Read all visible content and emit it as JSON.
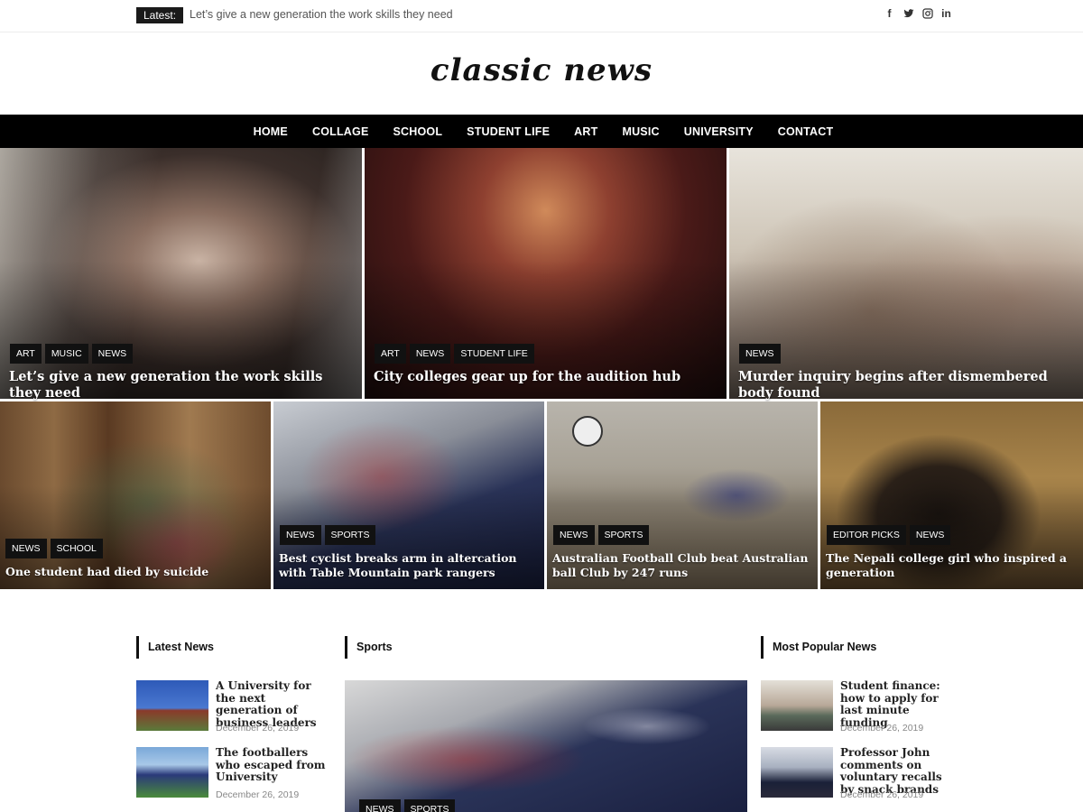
{
  "topbar": {
    "latest_label": "Latest:",
    "latest_text": "Let’s give a new generation the work skills they need",
    "social": [
      "facebook-icon",
      "twitter-icon",
      "instagram-icon",
      "linkedin-icon"
    ]
  },
  "site": {
    "logo": "classic news"
  },
  "nav": [
    "HOME",
    "COLLAGE",
    "SCHOOL",
    "STUDENT LIFE",
    "ART",
    "MUSIC",
    "UNIVERSITY",
    "CONTACT"
  ],
  "hero": [
    {
      "tags": [
        "ART",
        "MUSIC",
        "NEWS"
      ],
      "title": "Let’s give a new generation the work skills they need"
    },
    {
      "tags": [
        "ART",
        "NEWS",
        "STUDENT LIFE"
      ],
      "title": "City colleges gear up for the audition hub"
    },
    {
      "tags": [
        "NEWS"
      ],
      "title": "Murder inquiry begins after dismembered body found"
    }
  ],
  "grid": [
    {
      "tags": [
        "NEWS",
        "SCHOOL"
      ],
      "title": "One student had died by suicide"
    },
    {
      "tags": [
        "NEWS",
        "SPORTS"
      ],
      "title": "Best cyclist breaks arm in altercation with Table Mountain park rangers"
    },
    {
      "tags": [
        "NEWS",
        "SPORTS"
      ],
      "title": "Australian Football Club beat Australian ball Club by 247 runs"
    },
    {
      "tags": [
        "EDITOR PICKS",
        "NEWS"
      ],
      "title": "The Nepali college girl who inspired a generation"
    }
  ],
  "sections": {
    "latest": {
      "heading": "Latest News",
      "items": [
        {
          "title": "A University for the next generation of business leaders",
          "date": "December 26, 2019"
        },
        {
          "title": "The footballers who escaped from University",
          "date": "December 26, 2019"
        }
      ]
    },
    "sports": {
      "heading": "Sports",
      "tags": [
        "NEWS",
        "SPORTS"
      ]
    },
    "popular": {
      "heading": "Most Popular News",
      "items": [
        {
          "title": "Student finance: how to apply for last minute funding",
          "date": "December 26, 2019"
        },
        {
          "title": "Professor John comments on voluntary recalls by snack brands",
          "date": "December 26, 2019"
        }
      ]
    }
  },
  "colors": {
    "dark": "#111111",
    "nav_bg": "#000000",
    "date": "#888888"
  }
}
